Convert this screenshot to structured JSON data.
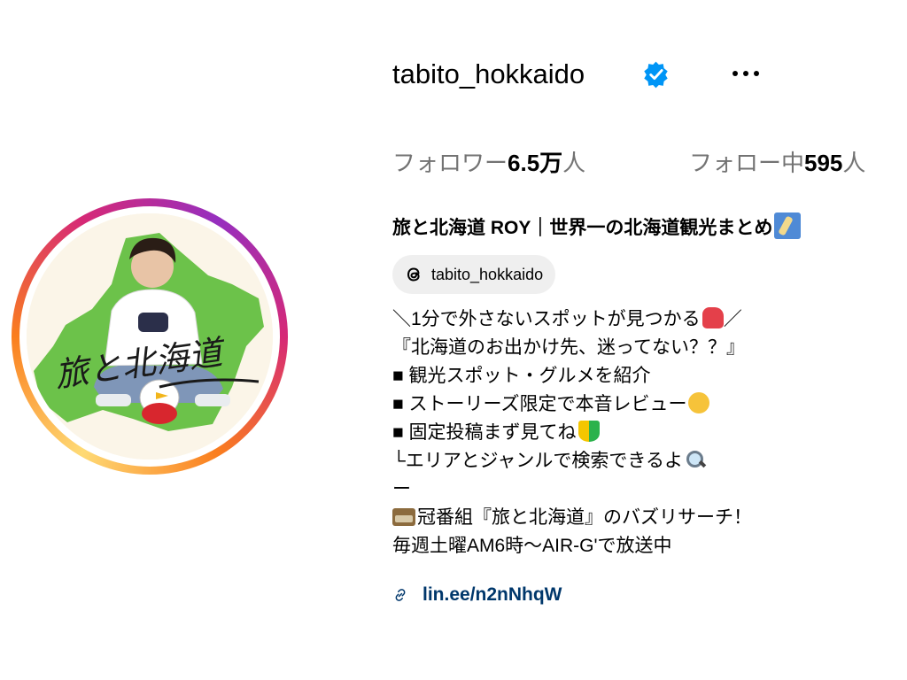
{
  "profile": {
    "username": "tabito_hokkaido",
    "verified_icon": "verified-badge-icon",
    "more_icon": "more-options-icon",
    "avatar_text": "旅と北海道",
    "stats": {
      "followers_label": "フォロワー",
      "followers_value": "6.5万",
      "followers_unit": "人",
      "following_label": "フォロー中",
      "following_value": "595",
      "following_unit": "人"
    },
    "full_name": "旅と北海道 ROY｜世界一の北海道観光まとめ",
    "threads_handle": "tabito_hokkaido",
    "bio": {
      "line1_a": "＼1分で外さないスポットが見つかる",
      "line1_b": "／",
      "line2": "『北海道のお出かけ先、迷ってない？？』",
      "line3": "■ 観光スポット・グルメを紹介",
      "line4": "■ ストーリーズ限定で本音レビュー",
      "line5": "■ 固定投稿まず見てね",
      "line6": "└エリアとジャンルで検索できるよ",
      "line7": "ー",
      "line8": "冠番組『旅と北海道』のバズリサーチ！",
      "line9": "毎週土曜AM6時〜AIR-G'で放送中"
    },
    "link": "lin.ee/n2nNhqW"
  },
  "colors": {
    "verified": "#0095f6",
    "link": "#00376b",
    "muted": "#737373",
    "chip_bg": "#efefef",
    "hokkaido_green": "#6cc24a"
  }
}
